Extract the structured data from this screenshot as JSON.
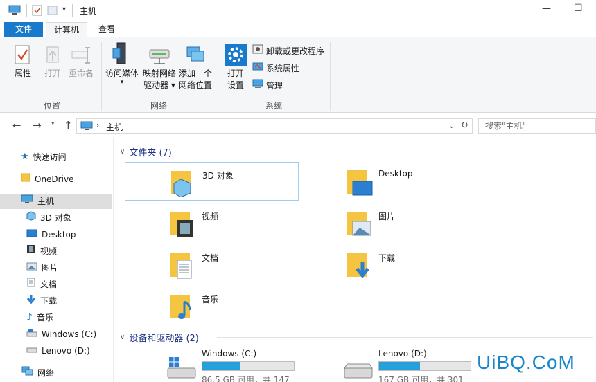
{
  "titlebar": {
    "title": "主机",
    "minimize": "—",
    "maximize": "☐"
  },
  "tabs": {
    "file": "文件",
    "computer": "计算机",
    "view": "查看"
  },
  "ribbon": {
    "location": {
      "label": "位置",
      "properties": "属性",
      "open": "打开",
      "rename": "重命名"
    },
    "network": {
      "label": "网络",
      "access_media_1": "访问媒体",
      "map_drive_1": "映射网络",
      "map_drive_2": "驱动器 ▾",
      "add_location_1": "添加一个",
      "add_location_2": "网络位置"
    },
    "system": {
      "label": "系统",
      "open_settings_1": "打开",
      "open_settings_2": "设置",
      "uninstall": "卸载或更改程序",
      "system_properties": "系统属性",
      "manage": "管理"
    }
  },
  "address": {
    "path": "主机",
    "search_placeholder": "搜索\"主机\""
  },
  "nav": {
    "quick_access": "快速访问",
    "onedrive": "OneDrive",
    "this_pc": "主机",
    "items": [
      "3D 对象",
      "Desktop",
      "视频",
      "图片",
      "文档",
      "下载",
      "音乐",
      "Windows (C:)",
      "Lenovo (D:)"
    ],
    "network": "网络"
  },
  "folders_header": "文件夹 (7)",
  "folders": [
    "3D 对象",
    "Desktop",
    "视频",
    "图片",
    "文档",
    "下载",
    "音乐"
  ],
  "drives_header": "设备和驱动器 (2)",
  "drives": [
    {
      "name": "Windows (C:)",
      "free_text": "86.5 GB 可用，共 147",
      "used_fraction": 0.41
    },
    {
      "name": "Lenovo (D:)",
      "free_text": "167 GB 可用，共 301",
      "used_fraction": 0.45
    }
  ],
  "watermark": "UiBQ.CoM",
  "colors": {
    "accent": "#1979ca",
    "folder": "#f5c542",
    "header_text": "#1e3287",
    "drive_fill": "#26a0da"
  }
}
